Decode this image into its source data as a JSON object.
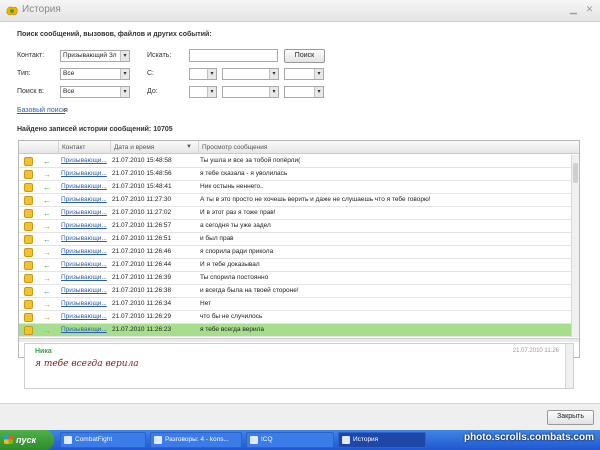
{
  "window": {
    "title": "История"
  },
  "search": {
    "heading": "Поиск сообщений, вызовов, файлов и других событий:",
    "contact_label": "Контакт:",
    "contact_value": "Призывающий Зл",
    "search_label": "Искать:",
    "search_value": "",
    "search_button": "Поиск",
    "type_label": "Тип:",
    "type_value": "Все",
    "from_label": "С:",
    "search_in_label": "Поиск в:",
    "search_in_value": "Все",
    "to_label": "До:",
    "basic_search_link": "Базовый поиск",
    "basic_search_suffix": "я"
  },
  "results": {
    "found_text": "Найдено записей истории сообщений: 10705",
    "columns": [
      "Контакт",
      "Дата и время",
      "Просмотр сообщения"
    ],
    "rows": [
      {
        "dir": "in",
        "contact": "Призывающи...",
        "datetime": "21.07.2010 15:48:58",
        "message": "Ты ушла и все за тобой попёрли("
      },
      {
        "dir": "out",
        "contact": "Призывающи...",
        "datetime": "21.07.2010 15:48:56",
        "message": "я тебе сказала - я уволилась"
      },
      {
        "dir": "in",
        "contact": "Призывающи...",
        "datetime": "21.07.2010 15:48:41",
        "message": "Ник остынь неннего.."
      },
      {
        "dir": "in",
        "contact": "Призывающи...",
        "datetime": "21.07.2010 11:27:30",
        "message": "А ты в это просто не хочешь верить и даже не слушаешь что я тебе говорю!"
      },
      {
        "dir": "in",
        "contact": "Призывающи...",
        "datetime": "21.07.2010 11:27:02",
        "message": "И в этот раз я тоже прав!"
      },
      {
        "dir": "out",
        "contact": "Призывающи...",
        "datetime": "21.07.2010 11:26:57",
        "message": "а сегодня ты уже задел"
      },
      {
        "dir": "in",
        "contact": "Призывающи...",
        "datetime": "21.07.2010 11:26:51",
        "message": "и был прав"
      },
      {
        "dir": "out",
        "contact": "Призывающи...",
        "datetime": "21.07.2010 11:26:46",
        "message": "я спорила ради прикола"
      },
      {
        "dir": "in",
        "contact": "Призывающи...",
        "datetime": "21.07.2010 11:26:44",
        "message": "И я тебе доказывал"
      },
      {
        "dir": "out",
        "contact": "Призывающи...",
        "datetime": "21.07.2010 11:26:39",
        "message": "Ты спорила постоянно"
      },
      {
        "dir": "in",
        "contact": "Призывающи...",
        "datetime": "21.07.2010 11:26:38",
        "message": "и всегда была на твоей стороне!"
      },
      {
        "dir": "out",
        "contact": "Призывающи...",
        "datetime": "21.07.2010 11:26:34",
        "message": "Нет"
      },
      {
        "dir": "out",
        "contact": "Призывающи...",
        "datetime": "21.07.2010 11:26:29",
        "message": "что бы не случилось"
      },
      {
        "dir": "out",
        "contact": "Призывающи...",
        "datetime": "21.07.2010 11:26:23",
        "message": "я тебе всегда верила",
        "selected": true
      }
    ]
  },
  "preview": {
    "name": "Ника",
    "time": "21.07.2010 11:26",
    "text": "я тебе всегда верила"
  },
  "footer": {
    "close_button": "Закрыть"
  },
  "taskbar": {
    "start_label": "пуск",
    "tasks": [
      "CombatFight",
      "Разговоры: 4 - kons...",
      "ICQ",
      "История"
    ]
  },
  "watermark": "photo.scrolls.combats.com",
  "colors": {
    "selected_row": "#a7de8e",
    "incoming_arrow": "#3aa34a",
    "outgoing_arrow": "#e98c16",
    "link": "#2a5db0"
  }
}
